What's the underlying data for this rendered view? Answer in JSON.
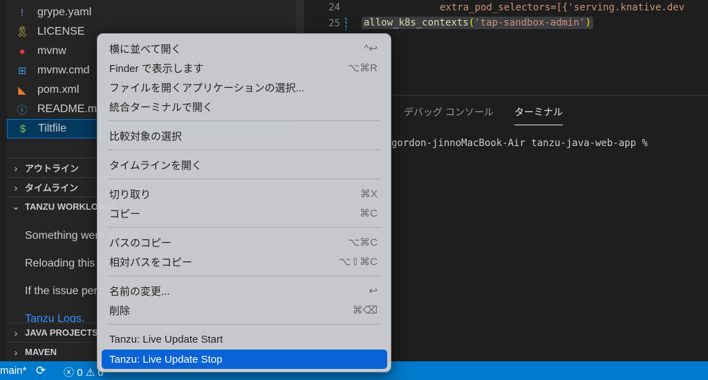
{
  "explorer": {
    "files": [
      {
        "name": "grype.yaml",
        "icon": "!",
        "color": "#a074c4"
      },
      {
        "name": "LICENSE",
        "icon": "🎗",
        "color": "#cbcb41"
      },
      {
        "name": "mvnw",
        "icon": "●",
        "color": "#e03b3b"
      },
      {
        "name": "mvnw.cmd",
        "icon": "⊞",
        "color": "#3a96dd"
      },
      {
        "name": "pom.xml",
        "icon": "◣",
        "color": "#e37933"
      },
      {
        "name": "README.md",
        "icon": "ⓘ",
        "color": "#519aba"
      },
      {
        "name": "Tiltfile",
        "icon": "$",
        "color": "#8dc149"
      }
    ],
    "sections": {
      "outline": "アウトライン",
      "timeline": "タイムライン",
      "tanzu": "TANZU WORKLOADS",
      "java": "JAVA PROJECTS",
      "maven": "MAVEN"
    },
    "tanzu_messages": [
      "Something went wrong",
      "Reloading this view",
      "If the issue persists"
    ],
    "tanzu_link": "Tanzu Logs."
  },
  "editor": {
    "lines": [
      {
        "num": "24",
        "text": "extra_pod_selectors=[{'serving.knative.dev"
      },
      {
        "num": "25",
        "fn": "allow_k8s_contexts",
        "open": "(",
        "str": "'tap-sandbox-admin'",
        "close": ")"
      }
    ]
  },
  "panel": {
    "tabs": [
      "デバッグ コンソール",
      "ターミナル"
    ],
    "terminal_line": "gordon-jinnoMacBook-Air tanzu-java-web-app %"
  },
  "status": {
    "branch": "main*",
    "errors": "0",
    "warnings": "0"
  },
  "menu": {
    "items": [
      {
        "label": "横に並べて開く",
        "shortcut": "^↩"
      },
      {
        "label": "Finder で表示します",
        "shortcut": "⌥⌘R"
      },
      {
        "label": "ファイルを開くアプリケーションの選択...",
        "shortcut": ""
      },
      {
        "label": "統合ターミナルで開く",
        "shortcut": ""
      },
      {
        "label": "比較対象の選択",
        "shortcut": ""
      },
      {
        "label": "タイムラインを開く",
        "shortcut": ""
      },
      {
        "label": "切り取り",
        "shortcut": "⌘X"
      },
      {
        "label": "コピー",
        "shortcut": "⌘C"
      },
      {
        "label": "パスのコピー",
        "shortcut": "⌥⌘C"
      },
      {
        "label": "相対パスをコピー",
        "shortcut": "⌥⇧⌘C"
      },
      {
        "label": "名前の変更...",
        "shortcut": "↩"
      },
      {
        "label": "削除",
        "shortcut": "⌘⌫"
      },
      {
        "label": "Tanzu: Live Update Start",
        "shortcut": ""
      },
      {
        "label": "Tanzu: Live Update Stop",
        "shortcut": ""
      }
    ]
  }
}
